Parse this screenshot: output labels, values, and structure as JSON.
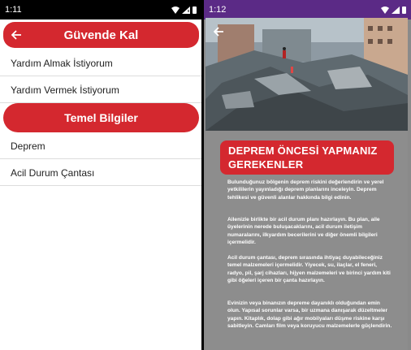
{
  "left_screen": {
    "status": {
      "time": "1:11"
    },
    "appbar": {
      "title": "Güvende Kal"
    },
    "menu_items": [
      {
        "label": "Yardım Almak İstiyorum"
      },
      {
        "label": "Yardım Vermek İstiyorum"
      }
    ],
    "section": {
      "title": "Temel Bilgiler"
    },
    "info_items": [
      {
        "label": "Deprem"
      },
      {
        "label": "Acil Durum Çantası"
      }
    ]
  },
  "right_screen": {
    "status": {
      "time": "1:12"
    },
    "heading": "DEPREM ÖNCESİ YAPMANIZ GEREKENLER",
    "paragraphs": [
      "Bulunduğunuz bölgenin deprem riskini değerlendirin ve yerel yetkililerin yayınladığı deprem planlarını inceleyin. Deprem tehlikesi ve güvenli alanlar hakkında bilgi edinin.",
      "Ailenizle birlikte bir acil durum planı hazırlayın. Bu plan, aile üyelerinin nerede buluşacaklarını, acil durum iletişim numaralarını, ilkyardım becerilerini ve diğer önemli bilgileri içermelidir.",
      "Acil durum çantası, deprem sırasında ihtiyaç duyabileceğiniz temel malzemeleri içermelidir. Yiyecek, su, ilaçlar, el feneri, radyo, pil, şarj cihazları, hijyen malzemeleri ve birinci yardım kiti gibi öğeleri içeren bir çanta hazırlayın.",
      "Evinizin veya binanızın depreme dayanıklı olduğundan emin olun. Yapısal sorunlar varsa, bir uzmana danışarak düzeltmeler yapın. Kitaplık, dolap gibi ağır mobilyaları düşme riskine karşı sabitleyin. Camları film veya koruyucu malzemelerle güçlendirin."
    ]
  },
  "colors": {
    "accent": "#d4282f",
    "status_purple": "#5b2a86",
    "content_gray": "#8d8d8d"
  }
}
